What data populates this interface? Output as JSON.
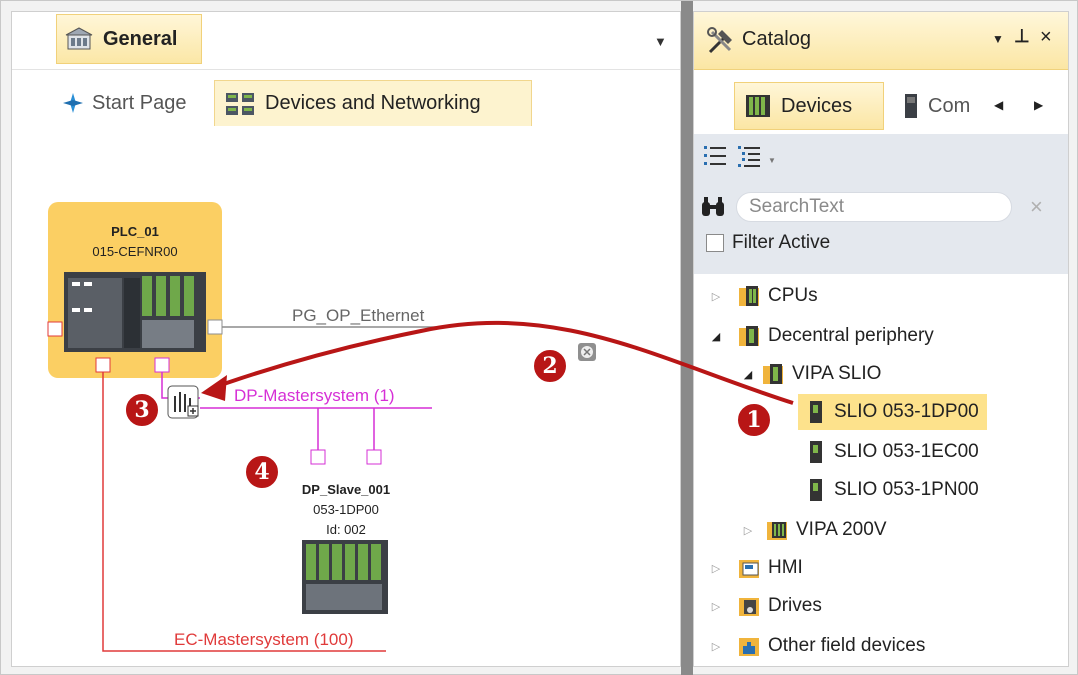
{
  "left_panel": {
    "document_tab": "General",
    "tabs": [
      {
        "label": "Start Page"
      },
      {
        "label": "Devices and Networking"
      }
    ]
  },
  "canvas": {
    "plc": {
      "name": "PLC_01",
      "model": "015-CEFNR00"
    },
    "networks": {
      "ethernet": "PG_OP_Ethernet",
      "dp": "DP-Mastersystem (1)",
      "ec": "EC-Mastersystem (100)"
    },
    "slave": {
      "name": "DP_Slave_001",
      "model": "053-1DP00",
      "id": "Id: 002"
    },
    "steps": [
      "1",
      "2",
      "3",
      "4"
    ]
  },
  "catalog": {
    "title": "Catalog",
    "header_controls": {
      "pin": "↓ ̧",
      "close": "×"
    },
    "tabs": [
      {
        "label": "Devices"
      },
      {
        "label": "Com"
      }
    ],
    "search": {
      "placeholder": "SearchText"
    },
    "filter_label": "Filter Active",
    "tree": [
      {
        "label": "CPUs"
      },
      {
        "label": "Decentral periphery"
      },
      {
        "label": "VIPA SLIO"
      },
      {
        "label": "SLIO 053-1DP00"
      },
      {
        "label": "SLIO 053-1EC00"
      },
      {
        "label": "SLIO 053-1PN00"
      },
      {
        "label": "VIPA 200V"
      },
      {
        "label": "HMI"
      },
      {
        "label": "Drives"
      },
      {
        "label": "Other field devices"
      }
    ]
  },
  "colors": {
    "accent": "#fbe6a4",
    "ethernet_line": "#8c8c8c",
    "dp_line": "#d62fd6",
    "ec_line": "#e03a3a",
    "arrow": "#b81616",
    "plc_box": "#fbcf63"
  }
}
